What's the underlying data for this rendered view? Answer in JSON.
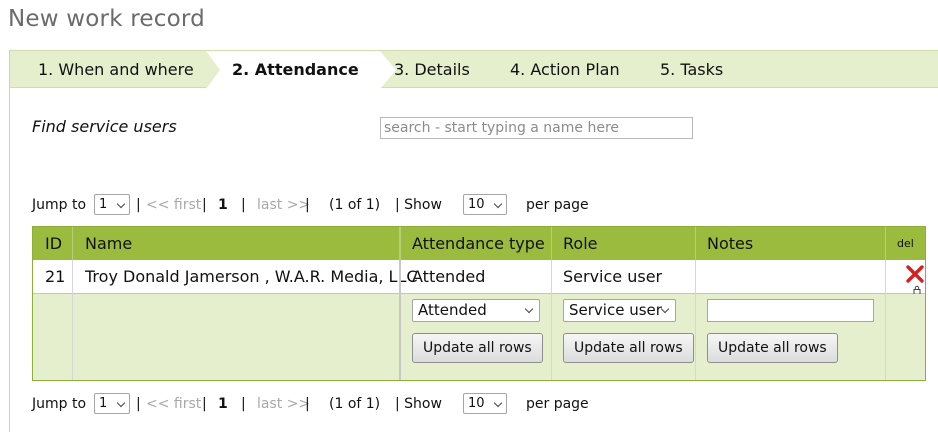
{
  "page": {
    "title": "New work record"
  },
  "steps": [
    {
      "label": "1. When and where",
      "active": false
    },
    {
      "label": "2. Attendance",
      "active": true
    },
    {
      "label": "3. Details",
      "active": false
    },
    {
      "label": "4. Action Plan",
      "active": false
    },
    {
      "label": "5. Tasks",
      "active": false
    }
  ],
  "find": {
    "label": "Find service users",
    "placeholder": "search - start typing a name here",
    "value": ""
  },
  "pager": {
    "jump_label": "Jump to",
    "jump_value": "1",
    "sep1": "|",
    "first": "<< first",
    "sep2": "|",
    "current": "1",
    "sep3": "|",
    "last": "last >>",
    "sep4": "|",
    "page_info": "(1 of 1)",
    "show_label": "| Show",
    "per_page_value": "10",
    "per_page_label": "per page"
  },
  "table": {
    "columns": {
      "id": "ID",
      "name": "Name",
      "attendance": "Attendance type",
      "role": "Role",
      "notes": "Notes",
      "del": "del"
    },
    "rows": [
      {
        "id": "21",
        "name": "Troy Donald Jamerson , W.A.R. Media, LLC",
        "attendance": "Attended",
        "role": "Service user",
        "notes": ""
      }
    ],
    "bulk": {
      "attendance_value": "Attended",
      "role_value": "Service user",
      "notes_value": "",
      "update_label": "Update all rows"
    }
  },
  "icons": {
    "delete": "delete-x-icon",
    "lock": "lock-icon",
    "chevron": "chevron-down-icon"
  },
  "colors": {
    "header_green": "#9bbb3f",
    "light_green": "#e5efcd",
    "delete_red": "#d61f1f",
    "title_grey": "#6b6b6b"
  }
}
